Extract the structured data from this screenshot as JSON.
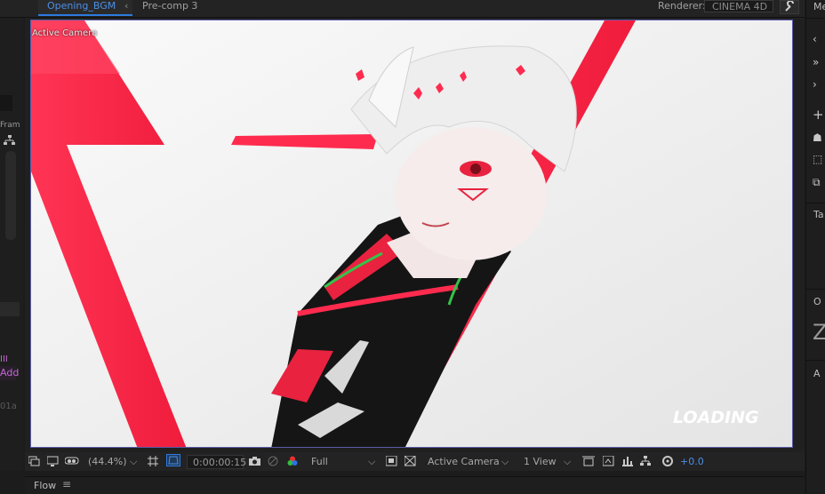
{
  "tabs": {
    "active": "Opening_BGM",
    "arrow": "‹",
    "other": "Pre-comp 3"
  },
  "renderer": {
    "label": "Renderer:",
    "value": "CINEMA 4D"
  },
  "left_panel": {
    "frame_label": "Fram",
    "add_label": "Add",
    "bars": "III",
    "timecode_fragment": "01a"
  },
  "viewer": {
    "camera_label": "Active Camera",
    "overlay_text": "LOADING"
  },
  "toolbar": {
    "magnification": "(44.4%)",
    "timecode": "0:00:00:15",
    "resolution": "Full",
    "camera": "Active Camera",
    "views": "1 View",
    "exposure": "+0.0"
  },
  "flow_panel": {
    "title": "Flow",
    "menu_icon": "≡"
  },
  "right_panel": {
    "top_label": "Me",
    "tab_label": "Ta",
    "o_label": "O",
    "z_glyph": "Z",
    "a_label": "A"
  },
  "colors": {
    "accent_blue": "#2d7be0",
    "brand_red": "#ff2b4e",
    "exposure_blue": "#4b8fe8",
    "label_purple": "#c569d3"
  }
}
